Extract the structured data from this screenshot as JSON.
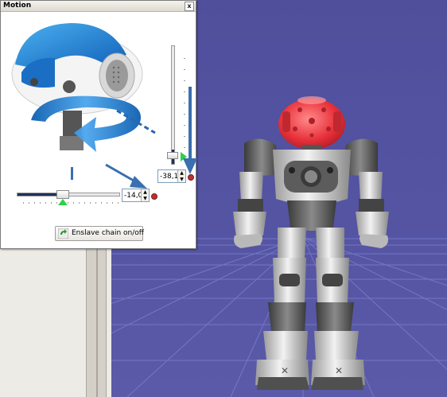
{
  "motion_window": {
    "title": "Motion",
    "close_glyph": "x",
    "pitch_value": "-38,1",
    "yaw_value": "-14,0",
    "enslave_label": "Enslave chain on/off",
    "yaw_slider_level": 0.42,
    "pitch_slider_level": 0.12
  },
  "colors": {
    "viewport_bg": "#5050a0",
    "grid_line": "#8a8ad8",
    "head_red": "#e8303a",
    "robot_white": "#dcdcdc",
    "robot_grey": "#6a6a6a",
    "arrow_blue": "#3a6fb0",
    "slider_fill": "#20305a",
    "green_marker": "#2fd04a"
  },
  "icons": [
    "close-icon",
    "enslave-chain-icon",
    "reset-dot-icon"
  ]
}
